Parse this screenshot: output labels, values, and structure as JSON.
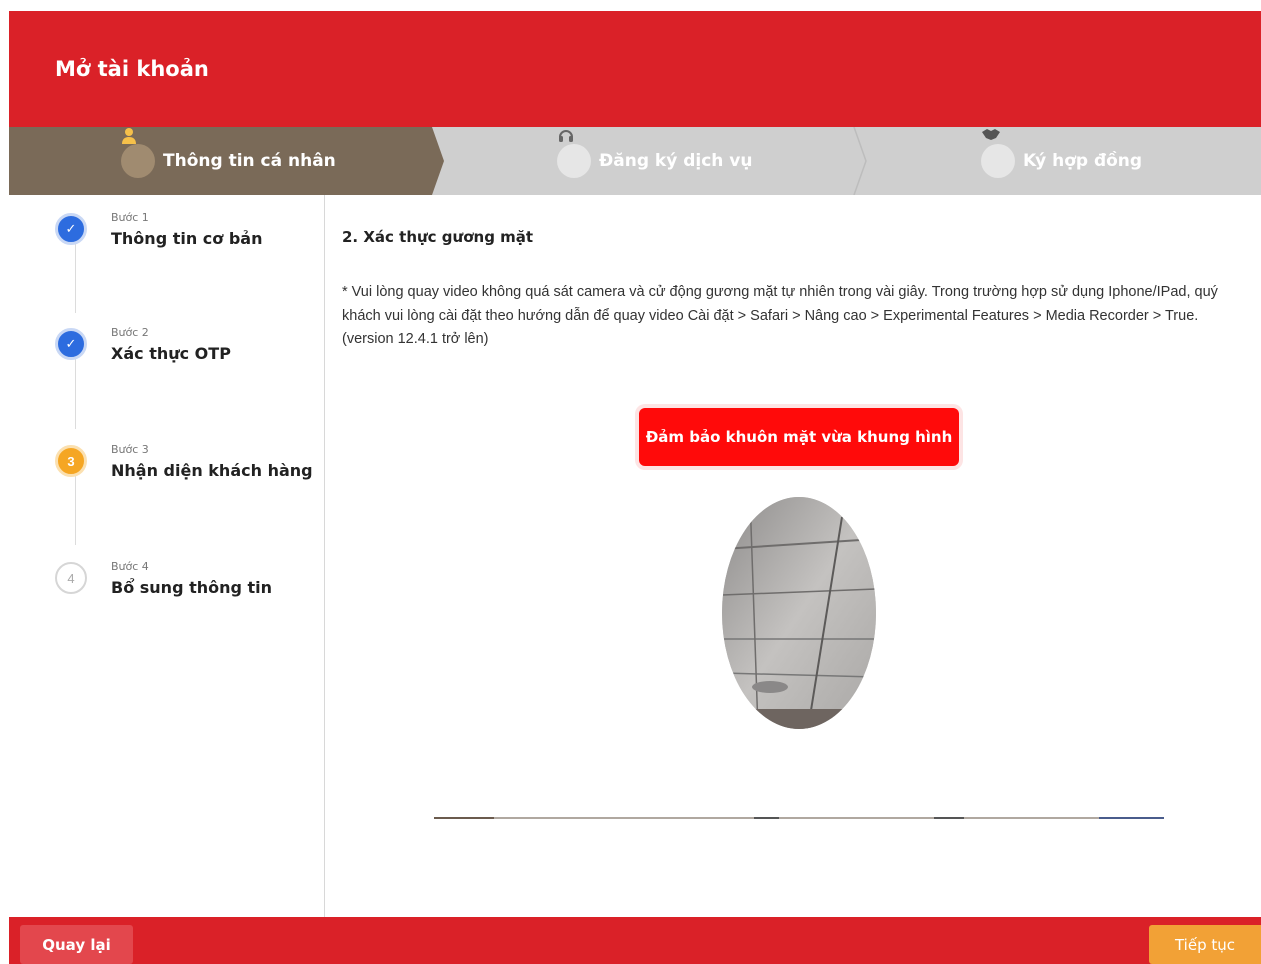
{
  "header": {
    "title": "Mở tài khoản"
  },
  "tabs": [
    {
      "label": "Thông tin cá nhân",
      "icon": "user-icon",
      "active": true
    },
    {
      "label": "Đăng ký dịch vụ",
      "icon": "headset-icon",
      "active": false
    },
    {
      "label": "Ký hợp đồng",
      "icon": "handshake-icon",
      "active": false
    }
  ],
  "steps": [
    {
      "label": "Bước 1",
      "name": "Thông tin cơ bản",
      "status": "done",
      "number": "1"
    },
    {
      "label": "Bước 2",
      "name": "Xác thực OTP",
      "status": "done",
      "number": "2"
    },
    {
      "label": "Bước 3",
      "name": "Nhận diện khách hàng",
      "status": "active",
      "number": "3"
    },
    {
      "label": "Bước 4",
      "name": "Bổ sung thông tin",
      "status": "todo",
      "number": "4"
    }
  ],
  "content": {
    "title": "2. Xác thực gương mặt",
    "note": "* Vui lòng quay video không quá sát camera và cử động gương mặt tự nhiên trong vài giây. Trong trường hợp sử dụng Iphone/IPad, quý khách vui lòng cài đặt theo hướng dẫn để quay video Cài đặt > Safari > Nâng cao > Experimental Features > Media Recorder > True. (version 12.4.1 trở lên)",
    "face_message": "Đảm bảo khuôn mặt vừa khung hình"
  },
  "footer": {
    "back_label": "Quay lại",
    "next_label": "Tiếp tục"
  },
  "colors": {
    "brand_red": "#da2128",
    "active_tab": "#7a6a58",
    "step_done": "#2d6cdf",
    "step_active": "#f5a623",
    "next_button": "#f2a136"
  }
}
